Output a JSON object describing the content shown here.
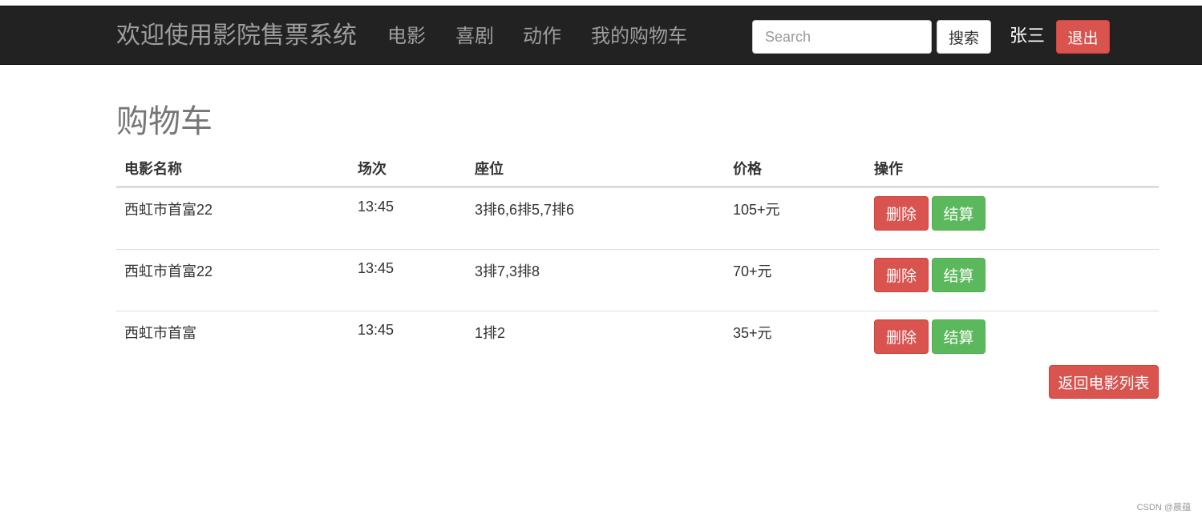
{
  "navbar": {
    "brand": "欢迎使用影院售票系统",
    "links": [
      "电影",
      "喜剧",
      "动作",
      "我的购物车"
    ],
    "search_placeholder": "Search",
    "search_button": "搜索",
    "username": "张三",
    "logout_button": "退出"
  },
  "page": {
    "title": "购物车"
  },
  "table": {
    "headers": [
      "电影名称",
      "场次",
      "座位",
      "价格",
      "操作"
    ],
    "rows": [
      {
        "movie": "西虹市首富22",
        "session": "13:45",
        "seats": "3排6,6排5,7排6",
        "price": "105+元"
      },
      {
        "movie": "西虹市首富22",
        "session": "13:45",
        "seats": "3排7,3排8",
        "price": "70+元"
      },
      {
        "movie": "西虹市首富",
        "session": "13:45",
        "seats": "1排2",
        "price": "35+元"
      }
    ],
    "delete_label": "删除",
    "checkout_label": "结算"
  },
  "back_button": "返回电影列表",
  "watermark": "CSDN @晨蕴",
  "colors": {
    "navbar_bg": "#222222",
    "danger": "#d9534f",
    "success": "#5cb85c"
  }
}
